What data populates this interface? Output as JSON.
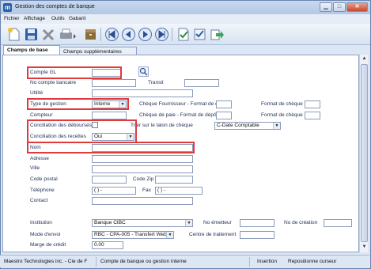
{
  "window": {
    "title": "Gestion des comptes de banque",
    "icon_letter": "m"
  },
  "menu": [
    "Fichier",
    "Affichage",
    "Outils",
    "Gabarit"
  ],
  "tabs": [
    "Champs de base",
    "Champs supplémentaires"
  ],
  "form": {
    "compte_gl_label": "Compte GL",
    "compte_gl_value": "",
    "no_compte_bancaire_label": "No compte bancaire",
    "transit_label": "Transit",
    "utilite_label": "Utilité",
    "type_gestion_label": "Type de gestion",
    "type_gestion_value": "Interne",
    "cheque_fournisseur_label": "Chèque Fournisseur - Format de dépôt",
    "format_cheque_label_1": "Format de chèque",
    "compteur_label": "Compteur",
    "cheque_paie_label": "Chèque de paie - Format de dépôt",
    "format_cheque_label_2": "Format de chèque",
    "conciliation_debourses_label": "Conciliation des déboursés",
    "trier_talon_label": "Trier sur le talon de chèque",
    "trier_talon_value": "C-Date Comptable",
    "conciliation_recettes_label": "Conciliation des recettes",
    "conciliation_recettes_value": "Oui",
    "nom_label": "Nom",
    "adresse_label": "Adresse",
    "ville_label": "Ville",
    "code_postal_label": "Code postal",
    "code_zip_label": "Code Zip",
    "telephone_label": "Téléphone",
    "telephone_value": "(   )     -",
    "fax_label": "Fax",
    "fax_value": "(   )     -",
    "contact_label": "Contact",
    "institution_label": "Institution",
    "institution_value": "Banque CIBC",
    "no_emetteur_label": "No émetteur",
    "no_creation_label": "No de création",
    "mode_envoi_label": "Mode d'envoi",
    "mode_envoi_value": "RBC - CPA-005 - Transfert Web ...",
    "centre_traitement_label": "Centre de traitement",
    "marge_credit_label": "Marge de crédit",
    "marge_credit_value": "0.00"
  },
  "status": {
    "company": "Maestro Technologies inc. - Cie de F",
    "description": "Compte de banque ou gestion interne",
    "mode": "Insertion",
    "cursor": "Repositionne curseur"
  },
  "colors": {
    "highlight": "#e03a3a",
    "accent": "#2a5fa8"
  },
  "icons": [
    "new-icon",
    "save-icon",
    "delete-icon",
    "print-icon",
    "archive-icon",
    "first-icon",
    "previous-icon",
    "next-icon",
    "last-icon",
    "validate-icon",
    "checklist-icon",
    "export-icon",
    "search-icon"
  ]
}
